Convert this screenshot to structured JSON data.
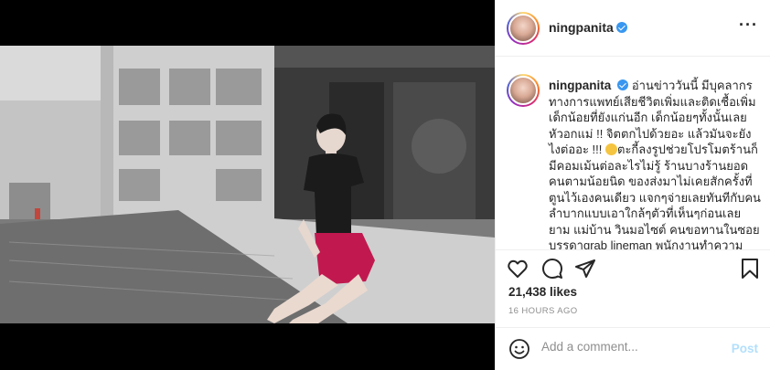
{
  "post": {
    "username": "ningpanita",
    "more_icon": "more-horizontal-icon",
    "caption": "อ่านข่าววันนี้ มีบุคลากรทางการแพทย์เสียชีวิตเพิ่มและติดเชื้อเพิ่ม เด็กน้อยที่ยังแก่นอีก เด็กน้อยๆทั้งนั้นเลย หัวอกแม่ !! จิตตกไปด้วยอะ แล้วมันจะยังไงต่ออะ !!! ",
    "caption_2": "ตะกี้ลงรูปช่วยโปรโมตร้านก็มีคอมเม้นต่อละไรไม่รู้ ร้านบางร้านยอดคนตามน้อยนิด ของส่งมาไม่เคยสักครั้งที่ตูนไว้เองคนเดียว แจกๆจ่ายเลยทันทีกับคนลำบากแบบเอาใกล้ๆตัวที่เห็นๆก่อนเลย ยาม แม่บ้าน วินมอไซต์ คนขอทานในซอย บรรดาgrab lineman พนักงานทำความสะอาด คนเก็บขยะ คนใกล้บ้านคนรถ ถ้าใครบ่าจะรู้สึกรำเลยจ้า ",
    "likes": "21,438 likes",
    "time": "16 HOURS AGO",
    "comment_placeholder": "Add a comment...",
    "post_label": "Post"
  },
  "colors": {
    "verified": "#3897f0",
    "post_button": "#b2dffc",
    "muted_text": "#8e8e8e"
  },
  "icons": [
    "heart-icon",
    "comment-icon",
    "share-icon",
    "bookmark-icon",
    "emoji-icon",
    "verified-badge-icon"
  ]
}
